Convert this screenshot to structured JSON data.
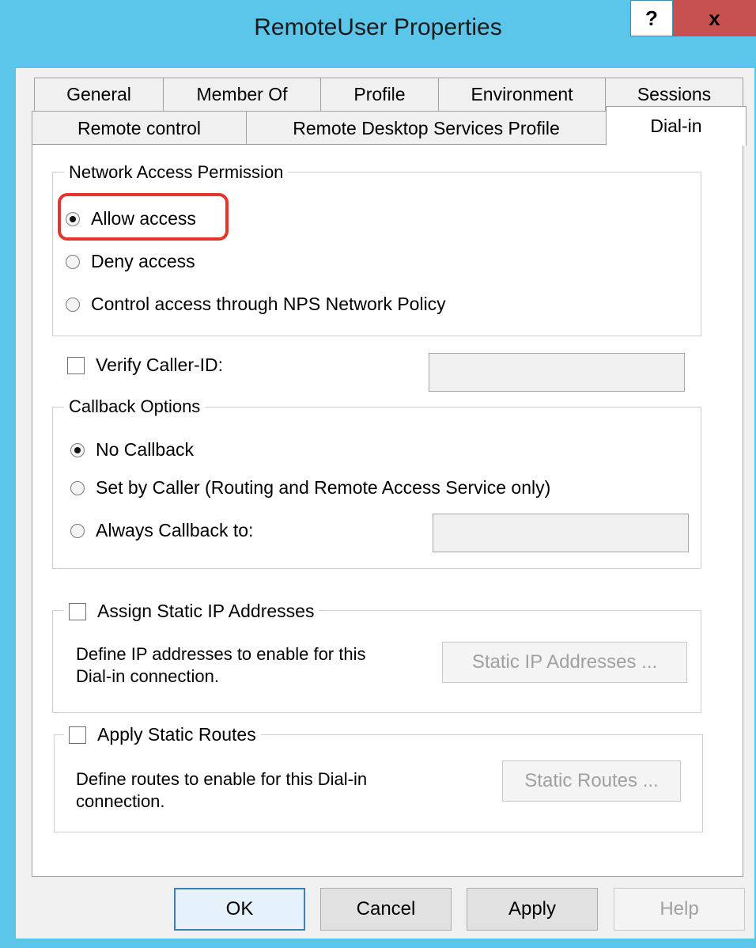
{
  "window": {
    "title": "RemoteUser Properties",
    "help_label": "?",
    "close_label": "x"
  },
  "tabs": {
    "row1": [
      "General",
      "Member Of",
      "Profile",
      "Environment",
      "Sessions"
    ],
    "row2": [
      "Remote control",
      "Remote Desktop Services Profile",
      "Dial-in"
    ],
    "active": "Dial-in"
  },
  "network_access": {
    "legend": "Network Access Permission",
    "options": [
      "Allow access",
      "Deny access",
      "Control access through NPS Network Policy"
    ],
    "selected": "Allow access"
  },
  "verify_caller": {
    "label": "Verify Caller-ID:",
    "checked": false,
    "value": ""
  },
  "callback": {
    "legend": "Callback Options",
    "options": [
      "No Callback",
      "Set by Caller (Routing and Remote Access Service only)",
      "Always Callback to:"
    ],
    "selected": "No Callback",
    "value": ""
  },
  "static_ip": {
    "label": "Assign Static IP Addresses",
    "checked": false,
    "description_line1": "Define IP addresses to enable for this",
    "description_line2": "Dial-in connection.",
    "button": "Static IP Addresses ..."
  },
  "static_routes": {
    "label": "Apply Static Routes",
    "checked": false,
    "description_line1": "Define routes to enable for this Dial-in",
    "description_line2": "connection.",
    "button": "Static Routes ..."
  },
  "buttons": {
    "ok": "OK",
    "cancel": "Cancel",
    "apply": "Apply",
    "help": "Help"
  },
  "colors": {
    "title_bar": "#5bc6ea",
    "close": "#c75050",
    "highlight": "#e2362d"
  }
}
